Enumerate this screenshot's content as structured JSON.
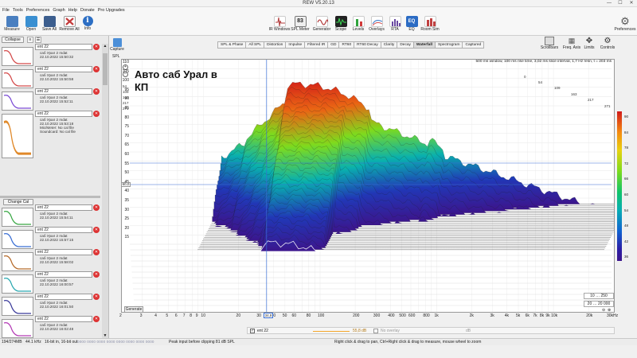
{
  "window": {
    "title": "REW V5.20.13"
  },
  "menu": [
    "File",
    "Tools",
    "Preferences",
    "Graph",
    "Help",
    "Donate",
    "Pro Upgrades"
  ],
  "toolbar": {
    "left": [
      {
        "label": "Measure",
        "icon": "measure-icon",
        "color": "#4a7fc0"
      },
      {
        "label": "Open",
        "icon": "folder-open-icon",
        "color": "#3a8fd1"
      },
      {
        "label": "Save All",
        "icon": "floppy-disk-icon",
        "color": "#3c5e8e"
      },
      {
        "label": "Remove All",
        "icon": "remove-all-icon",
        "color": "#c33a3a"
      },
      {
        "label": "Info",
        "icon": "info-icon",
        "color": "#2d6fc4"
      }
    ],
    "right": [
      {
        "label": "IR Windows",
        "icon": "ir-windows-icon",
        "color": "#b03939"
      },
      {
        "label": "SPL Meter",
        "icon": "spl-meter-icon",
        "color": "#555555",
        "readout": "83"
      },
      {
        "label": "Generator",
        "icon": "generator-icon",
        "color": "#b23a3a"
      },
      {
        "label": "Scope",
        "icon": "scope-icon",
        "color": "#2a2a2a"
      },
      {
        "label": "Levels",
        "icon": "levels-icon",
        "color": "#2fa33b"
      },
      {
        "label": "Overlays",
        "icon": "overlays-icon",
        "color": "#3d7cc9"
      },
      {
        "label": "RTA",
        "icon": "rta-icon",
        "color": "#6a4aa0"
      },
      {
        "label": "EQ",
        "icon": "eq-icon",
        "color": "#2c6cc4"
      },
      {
        "label": "Room Sim",
        "icon": "room-sim-icon",
        "color": "#c04040"
      }
    ],
    "preferences": {
      "label": "Preferences",
      "icon": "gear-icon"
    }
  },
  "sidebar": {
    "collapse_label": "Collapse",
    "change_cal_label": "Change Cal",
    "measurements": [
      {
        "name": "ent 22",
        "lines": [
          "саб Урал 2 mdat",
          "22.10.2022 15:50:32"
        ],
        "color": "#d44a4a"
      },
      {
        "name": "ent 22",
        "lines": [
          "саб Урал 2 mdat",
          "22.10.2022 15:50:58"
        ],
        "color": "#d44a4a"
      },
      {
        "name": "ent 22",
        "lines": [
          "саб Урал 2 mdat",
          "22.10.2022 15:52:11"
        ],
        "color": "#7a4ad4"
      },
      {
        "name": "ent 22",
        "lines": [
          "саб Урал 2 mdat",
          "22.10.2022 15:53:18",
          "Mic/Meter: No cal file",
          "Soundcard: No cal file"
        ],
        "color": "#e0892a"
      },
      {
        "name": "ent 22",
        "lines": [
          "саб Урал 2 mdat",
          "22.10.2022 15:54:11"
        ],
        "color": "#3aa845"
      },
      {
        "name": "ent 22",
        "lines": [
          "саб Урал 2 mdat",
          "22.10.2022 15:57:15"
        ],
        "color": "#3a6fd4"
      },
      {
        "name": "ent 22",
        "lines": [
          "саб Урал 2 mdat",
          "22.10.2022 15:58:02"
        ],
        "color": "#b56a2a"
      },
      {
        "name": "ent 22",
        "lines": [
          "саб Урал 2 mdat",
          "22.10.2022 16:00:57"
        ],
        "color": "#2aa8b0"
      },
      {
        "name": "ent 22",
        "lines": [
          "саб Урал 2 mdat",
          "22.10.2022 16:01:50"
        ],
        "color": "#3a3a9a"
      },
      {
        "name": "ent 22",
        "lines": [
          "саб Урал 2 mdat",
          "22.10.2022 16:02:48"
        ],
        "color": "#b33ab5"
      },
      {
        "name": "ent 22",
        "lines": [
          "саб Урал 2 mdat",
          "22.10.2022 16:03:41"
        ],
        "color": "#d23a8a"
      },
      {
        "name": "ent 22",
        "lines": [
          "саб Урал 2 mdat",
          "22.10.2022 16:04:32",
          "Mic/Meter: No cal file"
        ],
        "color": "#5a5ad0"
      }
    ]
  },
  "capture": {
    "label": "Capture",
    "spl_label": "SPL"
  },
  "graph_tabs": [
    "SPL & Phase",
    "All SPL",
    "Distortion",
    "Impulse",
    "Filtered IR",
    "GD",
    "RT60",
    "RT60 Decay",
    "Clarity",
    "Decay",
    "Waterfall",
    "Spectrogram",
    "Captured"
  ],
  "active_tab": "Waterfall",
  "right_tools": [
    {
      "label": "Scrollbars",
      "icon": "scrollbars-icon"
    },
    {
      "label": "Freq. Axis",
      "icon": "freq-axis-icon"
    },
    {
      "label": "Limits",
      "icon": "limits-icon"
    },
    {
      "label": "Controls",
      "icon": "controls-icon"
    }
  ],
  "plot": {
    "info": "500 ms window, 100 ms rise time, 3,02 ms slice interval, 1,7 Hz resn, t = 203 ms",
    "title": "Авто саб Урал в\nКП",
    "y_ticks": [
      "110",
      "105",
      "100",
      "95",
      "90",
      "85",
      "80",
      "75",
      "70",
      "65",
      "60",
      "55",
      "50",
      "45",
      "40",
      "35",
      "30",
      "25",
      "20",
      "15"
    ],
    "cursor_value": "60,0",
    "slice_labels": [
      "0",
      "54",
      "109",
      "163",
      "217",
      "271"
    ],
    "left_slice_labels": [
      "54",
      "109",
      "163",
      "217",
      "271"
    ],
    "generate_label": "Generate",
    "range1": "10 … 250",
    "range2": "20 … 20 000"
  },
  "chart_data": {
    "type": "heatmap",
    "title": "Авто саб Урал в\nКП",
    "xlabel": "Frequency (Hz)",
    "ylabel": "SPL (dB)",
    "x_axis_scale": "log",
    "x_ticks": [
      "2",
      "3",
      "4",
      "5",
      "6",
      "7",
      "8",
      "9",
      "10",
      "20",
      "30",
      "40",
      "50",
      "60",
      "80",
      "100",
      "200",
      "300",
      "400",
      "500",
      "600",
      "800",
      "1k",
      "2k",
      "3k",
      "4k",
      "5k",
      "6k",
      "7k",
      "8k",
      "9k",
      "10k",
      "20k",
      "30kHz"
    ],
    "ylim": [
      15,
      110
    ],
    "z_labels": [
      "90",
      "84",
      "78",
      "72",
      "66",
      "60",
      "54",
      "48",
      "42",
      "36"
    ],
    "z_range": [
      36,
      90
    ],
    "front_slice_peak": {
      "x": 40,
      "y": 97
    },
    "cursor_readout": "34,8"
  },
  "trace_bar": {
    "name1": "ent 22",
    "value1": "55,8 dB",
    "name2": "No overlay",
    "value2": "dB"
  },
  "status": {
    "memory": "194/274MB",
    "sample_rate": "44.1 kHz",
    "bits": "16-bit in, 16-bit out",
    "meter": "0000 0000 0000 0000 0000 0000 0000 0000",
    "peak": "Peak input before clipping 81 dB SPL",
    "hint": "Right click & drag to pan, Ctrl+Right click & drag to measure, mouse wheel to zoom"
  }
}
